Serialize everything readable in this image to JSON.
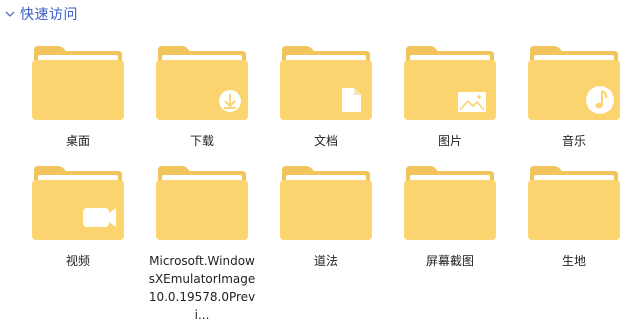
{
  "section": {
    "title": "快速访问",
    "collapse_icon": "chevron-down-icon"
  },
  "colors": {
    "title": "#3a5bc7",
    "folder_back": "#f2c55c",
    "folder_front": "#fbd46f",
    "folder_paper": "#ffffff",
    "overlay": "#ffffff"
  },
  "items": [
    {
      "label": "桌面",
      "overlay": "none"
    },
    {
      "label": "下载",
      "overlay": "download-icon"
    },
    {
      "label": "文档",
      "overlay": "document-icon"
    },
    {
      "label": "图片",
      "overlay": "picture-icon"
    },
    {
      "label": "音乐",
      "overlay": "music-note-icon"
    },
    {
      "label": "视频",
      "overlay": "video-camera-icon"
    },
    {
      "label": "Microsoft.WindowsXEmulatorImage10.0.19578.0Previ...",
      "overlay": "none"
    },
    {
      "label": "道法",
      "overlay": "none"
    },
    {
      "label": "屏幕截图",
      "overlay": "none"
    },
    {
      "label": "生地",
      "overlay": "none"
    }
  ]
}
